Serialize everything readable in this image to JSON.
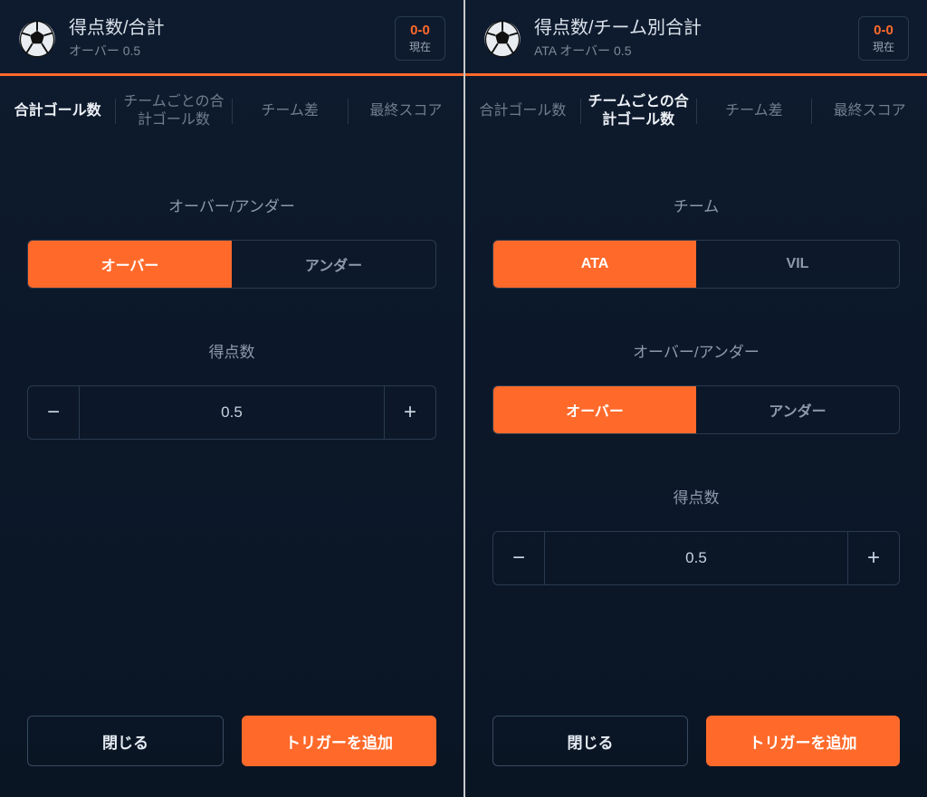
{
  "left": {
    "title": "得点数/合計",
    "subtitle": "オーバー 0.5",
    "score": "0-0",
    "score_label": "現在",
    "tabs": [
      "合計ゴール数",
      "チームごとの合計ゴール数",
      "チーム差",
      "最終スコア"
    ],
    "active_tab": 0,
    "ou_label": "オーバー/アンダー",
    "ou_options": [
      "オーバー",
      "アンダー"
    ],
    "ou_selected": 0,
    "points_label": "得点数",
    "points_value": "0.5",
    "close": "閉じる",
    "add": "トリガーを追加"
  },
  "right": {
    "title": "得点数/チーム別合計",
    "subtitle": "ATA オーバー 0.5",
    "score": "0-0",
    "score_label": "現在",
    "tabs": [
      "合計ゴール数",
      "チームごとの合計ゴール数",
      "チーム差",
      "最終スコア"
    ],
    "active_tab": 1,
    "team_label": "チーム",
    "team_options": [
      "ATA",
      "VIL"
    ],
    "team_selected": 0,
    "ou_label": "オーバー/アンダー",
    "ou_options": [
      "オーバー",
      "アンダー"
    ],
    "ou_selected": 0,
    "points_label": "得点数",
    "points_value": "0.5",
    "close": "閉じる",
    "add": "トリガーを追加"
  }
}
